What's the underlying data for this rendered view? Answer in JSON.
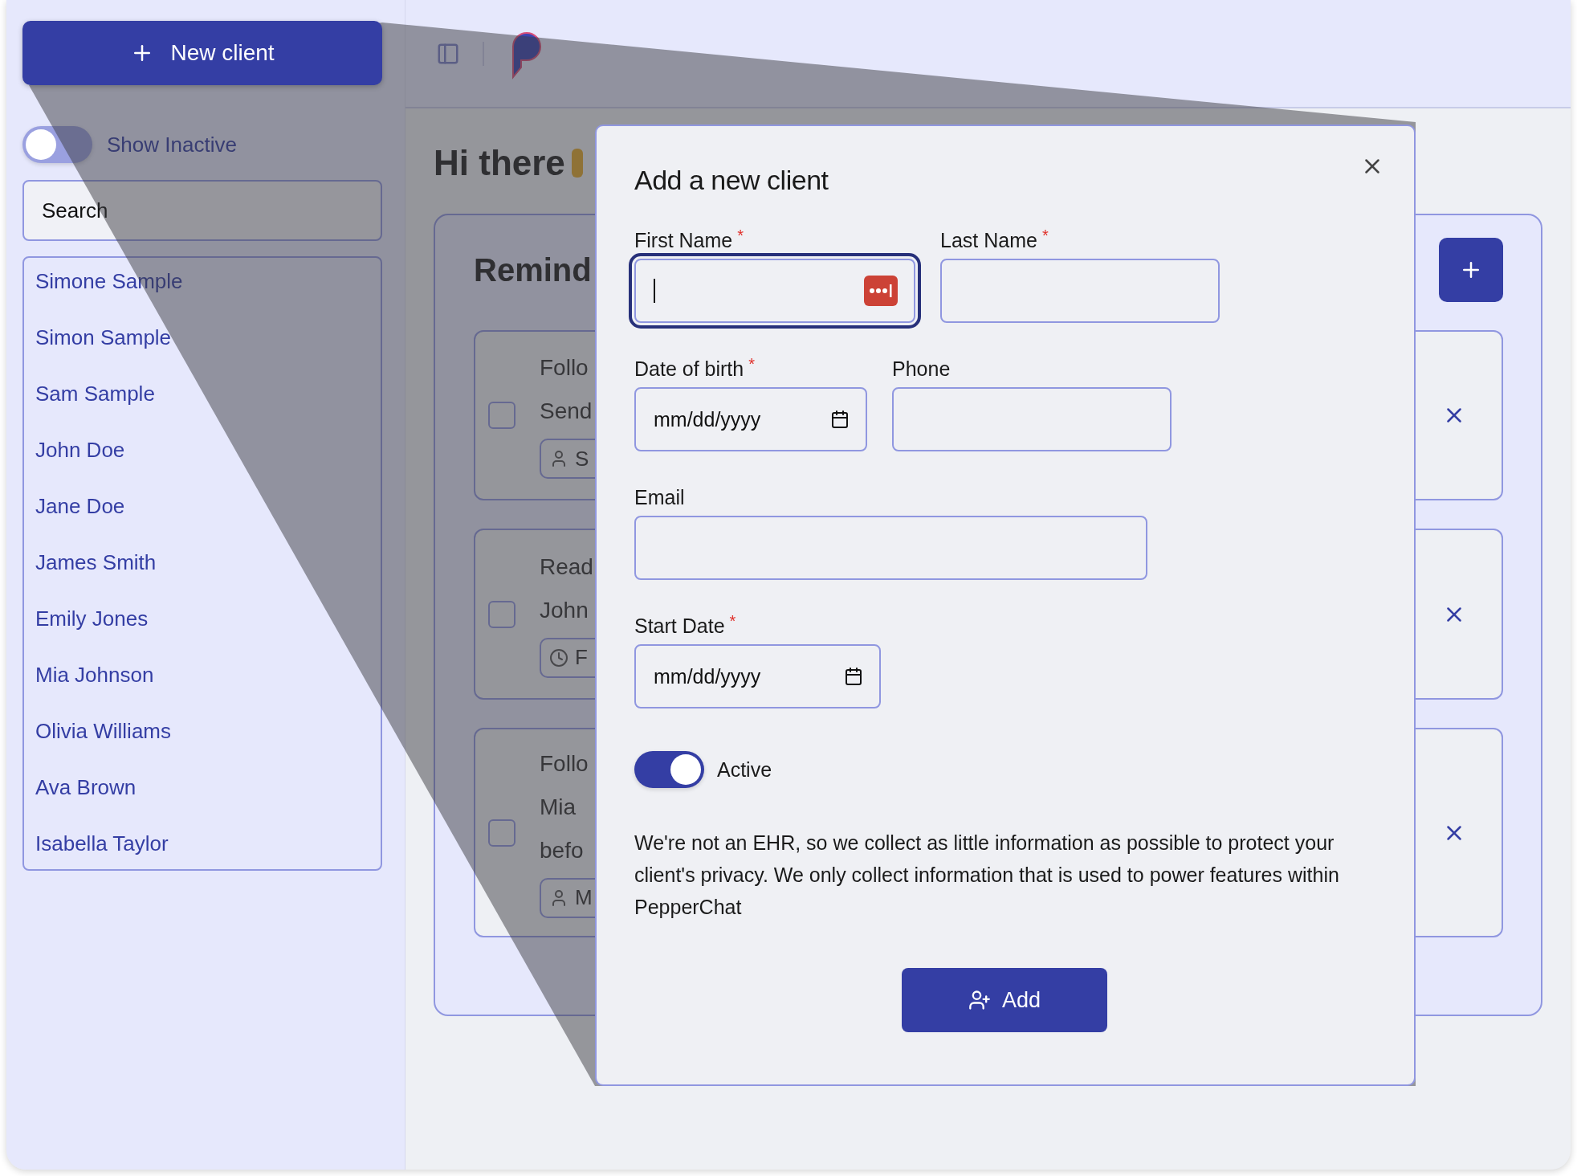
{
  "sidebar": {
    "new_client_button": "New client",
    "show_inactive": {
      "label": "Show Inactive",
      "on": false
    },
    "search": {
      "placeholder": "Search"
    },
    "clients": [
      "Simone Sample",
      "Simon Sample",
      "Sam Sample",
      "John Doe",
      "Jane Doe",
      "James Smith",
      "Emily Jones",
      "Mia Johnson",
      "Olivia Williams",
      "Ava Brown",
      "Isabella Taylor"
    ]
  },
  "main": {
    "greeting": "Hi there",
    "reminders": {
      "title": "Remind",
      "items": [
        {
          "lines": [
            "Follo",
            "Send"
          ],
          "chip": {
            "kind": "person",
            "text": "S"
          },
          "checked": false
        },
        {
          "lines": [
            "Read",
            "John"
          ],
          "chip": {
            "kind": "clock",
            "text": "F"
          },
          "checked": false
        },
        {
          "lines": [
            "Follo",
            "Mia",
            "befo"
          ],
          "chip": {
            "kind": "person",
            "text": "M"
          },
          "checked": false
        }
      ]
    }
  },
  "modal": {
    "title": "Add a new client",
    "field_rows": [
      [
        {
          "label": "First Name",
          "required_mark": "*",
          "kind": "text",
          "focused": true
        },
        {
          "label": "Last Name",
          "required_mark": "*",
          "kind": "text",
          "focused": false
        }
      ],
      [
        {
          "label": "Date of birth",
          "required_mark": "*",
          "kind": "date",
          "placeholder": "mm/dd/yyyy",
          "focused": false
        },
        {
          "label": "Phone",
          "kind": "text",
          "focused": false
        }
      ],
      [
        {
          "label": "Email",
          "kind": "text",
          "focused": false
        }
      ],
      [
        {
          "label": "Start Date",
          "required_mark": "*",
          "kind": "date",
          "placeholder": "mm/dd/yyyy",
          "focused": false
        }
      ]
    ],
    "active": {
      "label": "Active",
      "on": true
    },
    "note": "We're not an EHR, so we collect as little information as possible to protect your client's privacy. We only collect information that is used to power features within PepperChat",
    "submit": "Add"
  }
}
